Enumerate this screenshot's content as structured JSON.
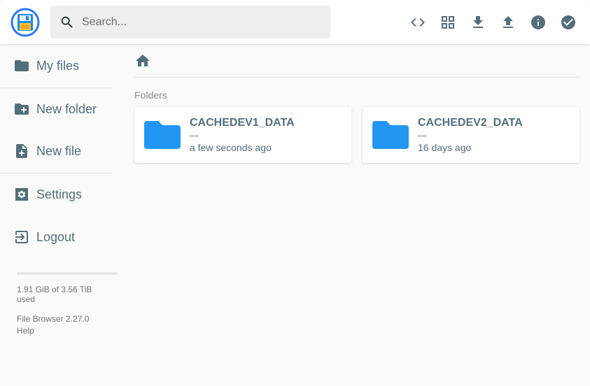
{
  "search": {
    "placeholder": "Search..."
  },
  "header": {
    "actions": [
      {
        "icon": "code-icon",
        "label": "Toggle shell"
      },
      {
        "icon": "grid-view-icon",
        "label": "Switch view"
      },
      {
        "icon": "download-icon",
        "label": "Download"
      },
      {
        "icon": "upload-icon",
        "label": "Upload"
      },
      {
        "icon": "info-icon",
        "label": "Info"
      },
      {
        "icon": "check-circle-icon",
        "label": "Select multiple"
      }
    ]
  },
  "sidebar": {
    "items": [
      {
        "icon": "folder-icon",
        "label": "My files"
      },
      {
        "icon": "create-new-folder-icon",
        "label": "New folder"
      },
      {
        "icon": "note-add-icon",
        "label": "New file"
      },
      {
        "icon": "settings-icon",
        "label": "Settings"
      },
      {
        "icon": "logout-icon",
        "label": "Logout"
      }
    ],
    "usage": {
      "text": "1.91 GiB of 3.56 TiB used",
      "fraction": 0.0005
    },
    "version": "File Browser 2.27.0",
    "help": "Help"
  },
  "main": {
    "breadcrumb": {
      "icon": "home-icon"
    },
    "section_title": "Folders",
    "folders": [
      {
        "name": "CACHEDEV1_DATA",
        "size": "—",
        "modified": "a few seconds ago"
      },
      {
        "name": "CACHEDEV2_DATA",
        "size": "—",
        "modified": "16 days ago"
      }
    ]
  },
  "colors": {
    "accent": "#2196f3",
    "icon": "#546e7a",
    "usage_fill": "#40c4ff"
  }
}
